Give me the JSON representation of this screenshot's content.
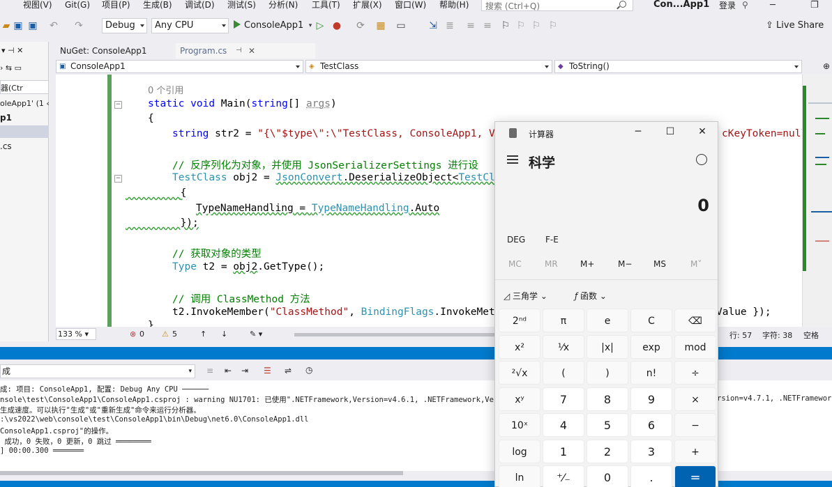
{
  "menu": [
    "视图(V)",
    "Git(G)",
    "项目(P)",
    "生成(B)",
    "调试(D)",
    "测试(S)",
    "分析(N)",
    "工具(T)",
    "扩展(X)",
    "窗口(W)",
    "帮助(H)"
  ],
  "search": {
    "placeholder": "搜索 (Ctrl+Q)"
  },
  "solution_title": "Con...App1",
  "login_label": "登录",
  "toolbar": {
    "config": "Debug",
    "platform": "Any CPU",
    "start_label": "ConsoleApp1",
    "live_share": "Live Share"
  },
  "left_panel": {
    "filter_placeholder": "器(Ctr",
    "lines": [
      "oleApp1' (1 ‹",
      "p1",
      ".cs"
    ]
  },
  "doc_tabs": {
    "nuget": "NuGet: ConsoleApp1",
    "program": "Program.cs"
  },
  "navbar": {
    "project": "ConsoleApp1",
    "class": "TestClass",
    "member": "ToString()"
  },
  "code": {
    "refs": "0 个引用",
    "l_main_kw1": "static",
    "l_main_kw2": "void",
    "l_main_name": " Main(",
    "l_main_kw3": "string",
    "l_main_rest": "[] ",
    "l_main_args": "args",
    "l_main_close": ")",
    "brace_open": "{",
    "str2_kw": "string",
    "str2_rest": " str2 = ",
    "str2_lit": "\"{\\\"$type\\\":\\\"TestClass, ConsoleApp1, Ve",
    "str2_tail": "cKeyToken=null",
    "comment1": "// 反序列化为对象，并使用 JsonSerializerSettings 进行设",
    "obj2_type": "TestClass",
    "obj2_rest": " obj2 = ",
    "obj2_json": "JsonConvert",
    "obj2_call": ".DeserializeObject<",
    "obj2_gen": "TestCla",
    "inner_open": "{",
    "tnh_name": "TypeNameHandling = ",
    "tnh_type": "TypeNameHandling",
    "tnh_val": ".Auto",
    "inner_close": "});",
    "comment2": "// 获取对象的类型",
    "t2_type": "Type",
    "t2_rest": " t2 = ",
    "t2_obj": "obj2",
    "t2_call": ".GetType();",
    "comment3": "// 调用 ClassMethod 方法",
    "invoke_pre": "t2.InvokeMember(",
    "invoke_str": "\"ClassMethod\"",
    "invoke_mid": ", ",
    "invoke_type": "BindingFlags",
    "invoke_rest": ".InvokeMeth",
    "invoke_tail": "Value });",
    "brace_close": "}"
  },
  "editor_status": {
    "zoom": "133 %",
    "errors": "0",
    "warnings": "5",
    "line": "行: 57",
    "char": "字符: 38",
    "spaces": "空格"
  },
  "output": {
    "source": "成",
    "lines": [
      "成: 项目: ConsoleApp1, 配置: Debug Any CPU ──────",
      "nsole\\test\\ConsoleApp1\\ConsoleApp1.csproj : warning NU1701: 已使用\".NETFramework,Version=v4.6.1, .NETFramework,Version",
      "生成速度。可以执行\"生成\"或\"重新生成\"命令来运行分析器。",
      ":\\vs2022\\web\\console\\test\\ConsoleApp1\\bin\\Debug\\net6.0\\ConsoleApp1.dll",
      "ConsoleApp1.csproj\"的操作。",
      " 成功，0 失败，0 更新，0 跳过 ════════",
      "] 00:00.300 ═══════"
    ],
    "right_fragment": "rsion=v4.7.1, .NETFramework"
  },
  "calculator": {
    "title": "计算器",
    "mode": "科学",
    "display": "0",
    "deg": "DEG",
    "fe": "F-E",
    "memory": [
      "MC",
      "MR",
      "M+",
      "M−",
      "MS",
      "M˅"
    ],
    "trig": "三角学",
    "func": "函数",
    "keys": [
      [
        "2ⁿᵈ",
        "π",
        "e",
        "C",
        "⌫"
      ],
      [
        "x²",
        "¹⁄x",
        "|x|",
        "exp",
        "mod"
      ],
      [
        "²√x",
        "(",
        ")",
        "n!",
        "÷"
      ],
      [
        "xʸ",
        "7",
        "8",
        "9",
        "×"
      ],
      [
        "10ˣ",
        "4",
        "5",
        "6",
        "−"
      ],
      [
        "log",
        "1",
        "2",
        "3",
        "+"
      ],
      [
        "ln",
        "⁺⁄₋",
        "0",
        ".",
        "="
      ]
    ]
  },
  "colors": {
    "accent": "#007acc",
    "calc_equals": "#0063b1",
    "change_bar": "#5ba05b"
  }
}
